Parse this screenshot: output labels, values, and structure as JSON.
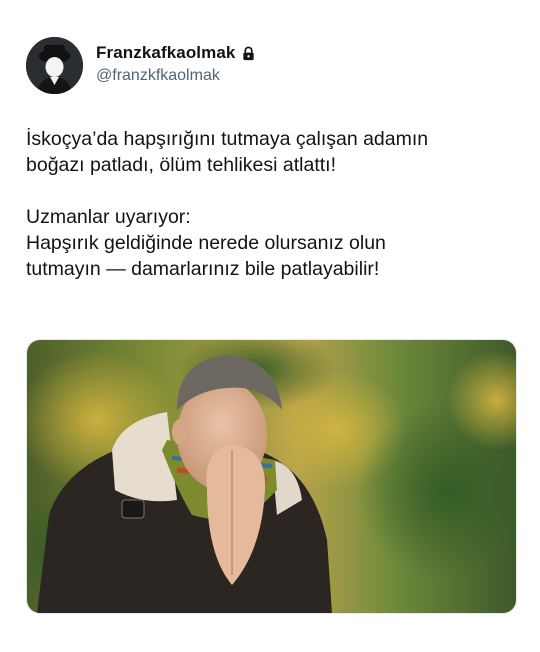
{
  "author": {
    "display_name": "Franzkafkaolmak",
    "handle": "@franzkfkaolmak",
    "protected_icon": "lock-icon",
    "avatar_icon": "avatar-silhouette-icon"
  },
  "tweet": {
    "lines": [
      "İskoçya’da hapşırığını tutmaya çalışan adamın",
      "boğazı patladı, ölüm tehlikesi atlattı!",
      "",
      "Uzmanlar uyarıyor:",
      "Hapşırık geldiğinde nerede olursanız olun",
      "tutmayın — damarlarınız bile patlayabilir!"
    ]
  },
  "media": {
    "subject": "man-sneezing-photo"
  },
  "colors": {
    "text": "#0f1419",
    "secondary": "#536471",
    "background": "#ffffff"
  }
}
